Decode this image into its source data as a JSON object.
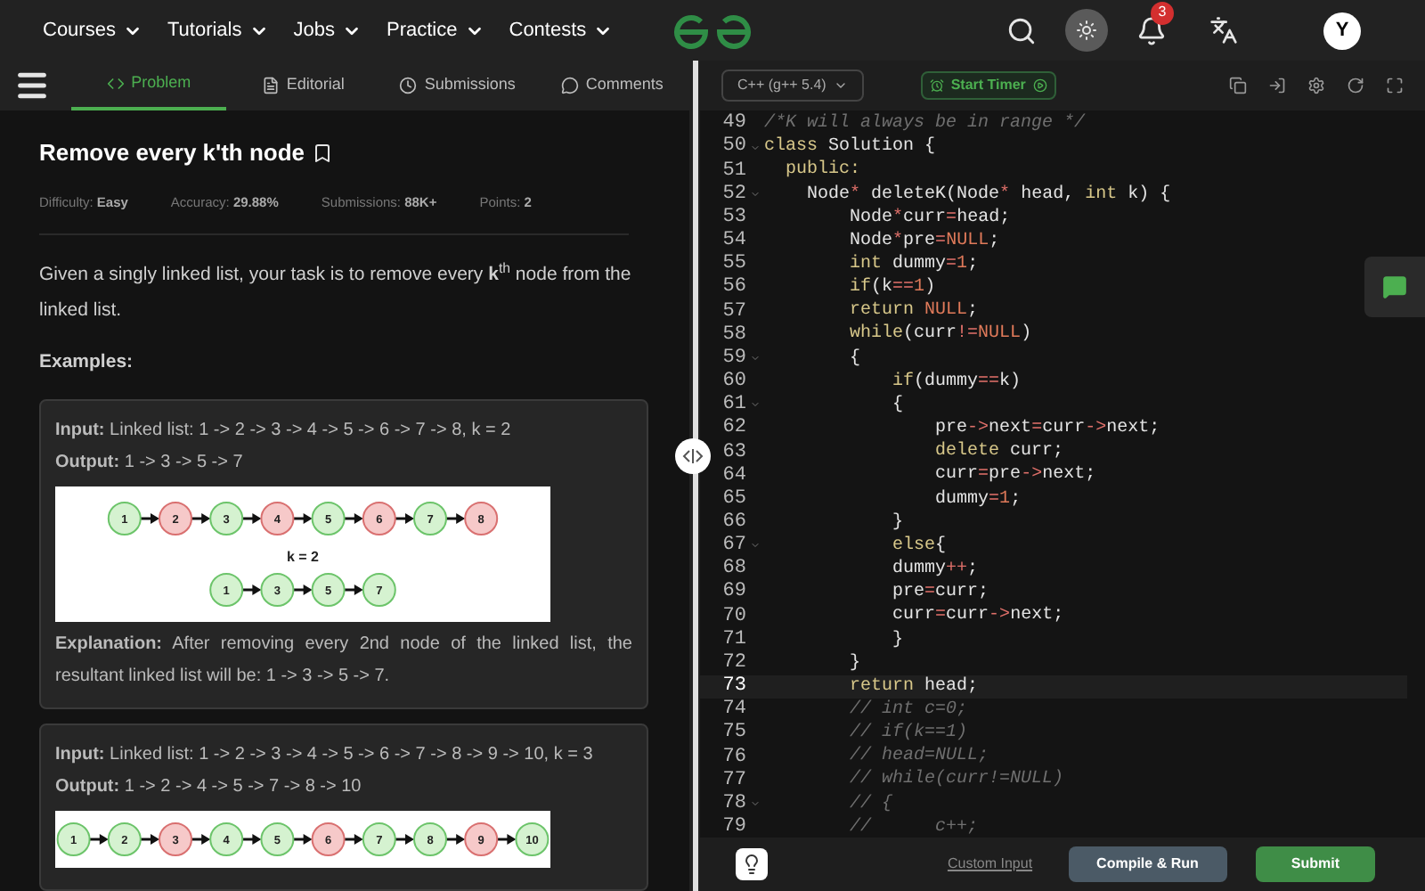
{
  "nav": {
    "menus": [
      "Courses",
      "Tutorials",
      "Jobs",
      "Practice",
      "Contests"
    ],
    "notifications": "3",
    "avatar": "Y"
  },
  "tabs": [
    {
      "label": "Problem",
      "selected": true
    },
    {
      "label": "Editorial",
      "selected": false
    },
    {
      "label": "Submissions",
      "selected": false
    },
    {
      "label": "Comments",
      "selected": false
    }
  ],
  "problem": {
    "title": "Remove every k'th node",
    "meta": [
      {
        "label": "Difficulty:",
        "value": "Easy"
      },
      {
        "label": "Accuracy:",
        "value": "29.88%"
      },
      {
        "label": "Submissions:",
        "value": "88K+"
      },
      {
        "label": "Points:",
        "value": "2"
      }
    ],
    "description": "Given a singly linked list, your task is to remove every **k**$^{th}$ node from the linked list.",
    "examples_heading": "Examples:",
    "examples": [
      {
        "lines": [
          "**Input:** Linked list: 1 -> 2 -> 3 -> 4 -> 5 -> 6 -> 7 -> 8, k = 2",
          "**Output:** 1 -> 3 -> 5 -> 7"
        ],
        "diagram": {
          "lists": [
            {
              "nodes": [
                {
                  "label": "1",
                  "removed": false
                },
                {
                  "label": "2",
                  "removed": true
                },
                {
                  "label": "3",
                  "removed": false
                },
                {
                  "label": "4",
                  "removed": true
                },
                {
                  "label": "5",
                  "removed": false
                },
                {
                  "label": "6",
                  "removed": true
                },
                {
                  "label": "7",
                  "removed": false
                },
                {
                  "label": "8",
                  "removed": true
                }
              ]
            },
            {
              "nodes": [
                {
                  "label": "1",
                  "removed": false
                },
                {
                  "label": "3",
                  "removed": false
                },
                {
                  "label": "5",
                  "removed": false
                },
                {
                  "label": "7",
                  "removed": false
                }
              ]
            }
          ],
          "caption": "k = 2"
        },
        "explanation": "**Explanation:** After removing every 2nd node of the linked list, the resultant linked list will be: 1 -> 3 -> 5 -> 7."
      },
      {
        "lines": [
          "**Input:** Linked list: 1 -> 2 -> 3 -> 4 -> 5 -> 6 -> 7 -> 8 -> 9 -> 10, k = 3",
          "**Output:** 1 -> 2 -> 4 -> 5 -> 7 -> 8 -> 10"
        ],
        "diagram": {
          "lists": [
            {
              "nodes": [
                {
                  "label": "1",
                  "removed": false
                },
                {
                  "label": "2",
                  "removed": false
                },
                {
                  "label": "3",
                  "removed": true
                },
                {
                  "label": "4",
                  "removed": false
                },
                {
                  "label": "5",
                  "removed": false
                },
                {
                  "label": "6",
                  "removed": true
                },
                {
                  "label": "7",
                  "removed": false
                },
                {
                  "label": "8",
                  "removed": false
                },
                {
                  "label": "9",
                  "removed": true
                },
                {
                  "label": "10",
                  "removed": false
                }
              ]
            }
          ]
        }
      }
    ]
  },
  "editor": {
    "language": "C++ (g++ 5.4)",
    "timer": "Start Timer",
    "lines": [
      {
        "number": "49",
        "fold": false,
        "current": false,
        "tokens": [
          {
            "kind": "comment",
            "text": "/*K will always be in range */"
          }
        ]
      },
      {
        "number": "50",
        "fold": true,
        "current": false,
        "tokens": [
          {
            "kind": "keyword",
            "text": "class"
          },
          {
            "kind": "plain",
            "text": " Solution {"
          }
        ]
      },
      {
        "number": "51",
        "fold": false,
        "current": false,
        "tokens": [
          {
            "kind": "keyword",
            "text": "  public:"
          }
        ]
      },
      {
        "number": "52",
        "fold": true,
        "current": false,
        "tokens": [
          {
            "kind": "plain",
            "text": "    Node"
          },
          {
            "kind": "op",
            "text": "*"
          },
          {
            "kind": "plain",
            "text": " deleteK(Node"
          },
          {
            "kind": "op",
            "text": "*"
          },
          {
            "kind": "plain",
            "text": " head, "
          },
          {
            "kind": "keyword",
            "text": "int"
          },
          {
            "kind": "plain",
            "text": " k) {"
          }
        ]
      },
      {
        "number": "53",
        "fold": false,
        "current": false,
        "tokens": [
          {
            "kind": "plain",
            "text": "        Node"
          },
          {
            "kind": "op",
            "text": "*"
          },
          {
            "kind": "plain",
            "text": "curr"
          },
          {
            "kind": "op",
            "text": "="
          },
          {
            "kind": "plain",
            "text": "head;"
          }
        ]
      },
      {
        "number": "54",
        "fold": false,
        "current": false,
        "tokens": [
          {
            "kind": "plain",
            "text": "        Node"
          },
          {
            "kind": "op",
            "text": "*"
          },
          {
            "kind": "plain",
            "text": "pre"
          },
          {
            "kind": "op",
            "text": "="
          },
          {
            "kind": "number",
            "text": "NULL"
          },
          {
            "kind": "plain",
            "text": ";"
          }
        ]
      },
      {
        "number": "55",
        "fold": false,
        "current": false,
        "tokens": [
          {
            "kind": "keyword",
            "text": "        int"
          },
          {
            "kind": "plain",
            "text": " dummy"
          },
          {
            "kind": "op",
            "text": "="
          },
          {
            "kind": "number",
            "text": "1"
          },
          {
            "kind": "plain",
            "text": ";"
          }
        ]
      },
      {
        "number": "56",
        "fold": false,
        "current": false,
        "tokens": [
          {
            "kind": "keyword",
            "text": "        if"
          },
          {
            "kind": "plain",
            "text": "(k"
          },
          {
            "kind": "op",
            "text": "=="
          },
          {
            "kind": "number",
            "text": "1"
          },
          {
            "kind": "plain",
            "text": ")"
          }
        ]
      },
      {
        "number": "57",
        "fold": false,
        "current": false,
        "tokens": [
          {
            "kind": "keyword",
            "text": "        return"
          },
          {
            "kind": "number",
            "text": " NULL"
          },
          {
            "kind": "plain",
            "text": ";"
          }
        ]
      },
      {
        "number": "58",
        "fold": false,
        "current": false,
        "tokens": [
          {
            "kind": "keyword",
            "text": "        while"
          },
          {
            "kind": "plain",
            "text": "(curr"
          },
          {
            "kind": "op",
            "text": "!="
          },
          {
            "kind": "number",
            "text": "NULL"
          },
          {
            "kind": "plain",
            "text": ")"
          }
        ]
      },
      {
        "number": "59",
        "fold": true,
        "current": false,
        "tokens": [
          {
            "kind": "plain",
            "text": "        {"
          }
        ]
      },
      {
        "number": "60",
        "fold": false,
        "current": false,
        "tokens": [
          {
            "kind": "keyword",
            "text": "            if"
          },
          {
            "kind": "plain",
            "text": "(dummy"
          },
          {
            "kind": "op",
            "text": "=="
          },
          {
            "kind": "plain",
            "text": "k)"
          }
        ]
      },
      {
        "number": "61",
        "fold": true,
        "current": false,
        "tokens": [
          {
            "kind": "plain",
            "text": "            {"
          }
        ]
      },
      {
        "number": "62",
        "fold": false,
        "current": false,
        "tokens": [
          {
            "kind": "plain",
            "text": "                pre"
          },
          {
            "kind": "op",
            "text": "->"
          },
          {
            "kind": "plain",
            "text": "next"
          },
          {
            "kind": "op",
            "text": "="
          },
          {
            "kind": "plain",
            "text": "curr"
          },
          {
            "kind": "op",
            "text": "->"
          },
          {
            "kind": "plain",
            "text": "next;"
          }
        ]
      },
      {
        "number": "63",
        "fold": false,
        "current": false,
        "tokens": [
          {
            "kind": "keyword",
            "text": "                delete"
          },
          {
            "kind": "plain",
            "text": " curr;"
          }
        ]
      },
      {
        "number": "64",
        "fold": false,
        "current": false,
        "tokens": [
          {
            "kind": "plain",
            "text": "                curr"
          },
          {
            "kind": "op",
            "text": "="
          },
          {
            "kind": "plain",
            "text": "pre"
          },
          {
            "kind": "op",
            "text": "->"
          },
          {
            "kind": "plain",
            "text": "next;"
          }
        ]
      },
      {
        "number": "65",
        "fold": false,
        "current": false,
        "tokens": [
          {
            "kind": "plain",
            "text": "                dummy"
          },
          {
            "kind": "op",
            "text": "="
          },
          {
            "kind": "number",
            "text": "1"
          },
          {
            "kind": "plain",
            "text": ";"
          }
        ]
      },
      {
        "number": "66",
        "fold": false,
        "current": false,
        "tokens": [
          {
            "kind": "plain",
            "text": "            }"
          }
        ]
      },
      {
        "number": "67",
        "fold": true,
        "current": false,
        "tokens": [
          {
            "kind": "keyword",
            "text": "            else"
          },
          {
            "kind": "plain",
            "text": "{"
          }
        ]
      },
      {
        "number": "68",
        "fold": false,
        "current": false,
        "tokens": [
          {
            "kind": "plain",
            "text": "            dummy"
          },
          {
            "kind": "op",
            "text": "++"
          },
          {
            "kind": "plain",
            "text": ";"
          }
        ]
      },
      {
        "number": "69",
        "fold": false,
        "current": false,
        "tokens": [
          {
            "kind": "plain",
            "text": "            pre"
          },
          {
            "kind": "op",
            "text": "="
          },
          {
            "kind": "plain",
            "text": "curr;"
          }
        ]
      },
      {
        "number": "70",
        "fold": false,
        "current": false,
        "tokens": [
          {
            "kind": "plain",
            "text": "            curr"
          },
          {
            "kind": "op",
            "text": "="
          },
          {
            "kind": "plain",
            "text": "curr"
          },
          {
            "kind": "op",
            "text": "->"
          },
          {
            "kind": "plain",
            "text": "next;"
          }
        ]
      },
      {
        "number": "71",
        "fold": false,
        "current": false,
        "tokens": [
          {
            "kind": "plain",
            "text": "            }"
          }
        ]
      },
      {
        "number": "72",
        "fold": false,
        "current": false,
        "tokens": [
          {
            "kind": "plain",
            "text": "        }"
          }
        ]
      },
      {
        "number": "73",
        "fold": false,
        "current": true,
        "tokens": [
          {
            "kind": "keyword",
            "text": "        return"
          },
          {
            "kind": "plain",
            "text": " head;"
          }
        ]
      },
      {
        "number": "74",
        "fold": false,
        "current": false,
        "tokens": [
          {
            "kind": "comment",
            "text": "        // int c=0;"
          }
        ]
      },
      {
        "number": "75",
        "fold": false,
        "current": false,
        "tokens": [
          {
            "kind": "comment",
            "text": "        // if(k==1)"
          }
        ]
      },
      {
        "number": "76",
        "fold": false,
        "current": false,
        "tokens": [
          {
            "kind": "comment",
            "text": "        // head=NULL;"
          }
        ]
      },
      {
        "number": "77",
        "fold": false,
        "current": false,
        "tokens": [
          {
            "kind": "comment",
            "text": "        // while(curr!=NULL)"
          }
        ]
      },
      {
        "number": "78",
        "fold": true,
        "current": false,
        "tokens": [
          {
            "kind": "comment",
            "text": "        // {"
          }
        ]
      },
      {
        "number": "79",
        "fold": false,
        "current": false,
        "tokens": [
          {
            "kind": "comment",
            "text": "        //      c++;"
          }
        ]
      }
    ]
  },
  "actions": {
    "custom_input": "Custom Input",
    "compile": "Compile & Run",
    "submit": "Submit"
  }
}
